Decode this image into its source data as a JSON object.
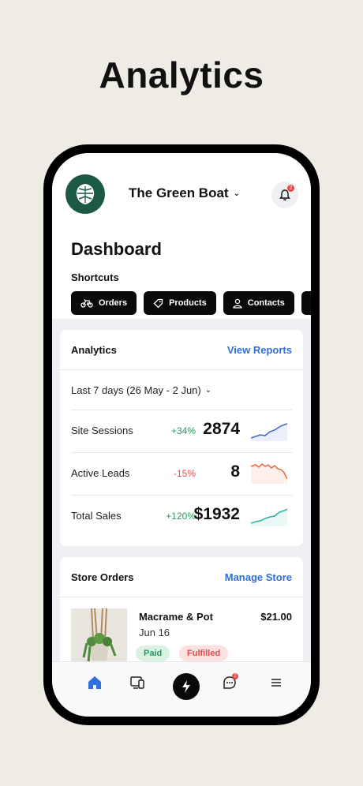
{
  "hero": {
    "title": "Analytics"
  },
  "header": {
    "site_name": "The Green Boat",
    "bell_badge": "2",
    "title": "Dashboard"
  },
  "shortcuts": {
    "label": "Shortcuts",
    "items": [
      {
        "label": "Orders",
        "icon": "bike-icon"
      },
      {
        "label": "Products",
        "icon": "tag-icon"
      },
      {
        "label": "Contacts",
        "icon": "person-icon"
      },
      {
        "label": "",
        "icon": "image-icon"
      }
    ]
  },
  "analytics": {
    "title": "Analytics",
    "link": "View Reports",
    "period": "Last 7 days (26 May - 2 Jun)",
    "metrics": [
      {
        "label": "Site Sessions",
        "change": "+34%",
        "value": "2874",
        "color": "#3a66d6"
      },
      {
        "label": "Active Leads",
        "change": "-15%",
        "value": "8",
        "color": "#e8673c"
      },
      {
        "label": "Total Sales",
        "change": "+120%",
        "value": "$1932",
        "color": "#2bb3a0"
      }
    ]
  },
  "store": {
    "title": "Store Orders",
    "link": "Manage Store",
    "order": {
      "name": "Macrame & Pot",
      "date": "Jun 16",
      "price": "$21.00",
      "status_paid": "Paid",
      "status_fulfilled": "Fulfilled"
    }
  },
  "tabbar": {
    "messages_badge": "2"
  },
  "colors": {
    "accent": "#2f6fdb",
    "brand": "#1d5a45",
    "positive": "#2a9a5f",
    "negative": "#e04a4a"
  }
}
